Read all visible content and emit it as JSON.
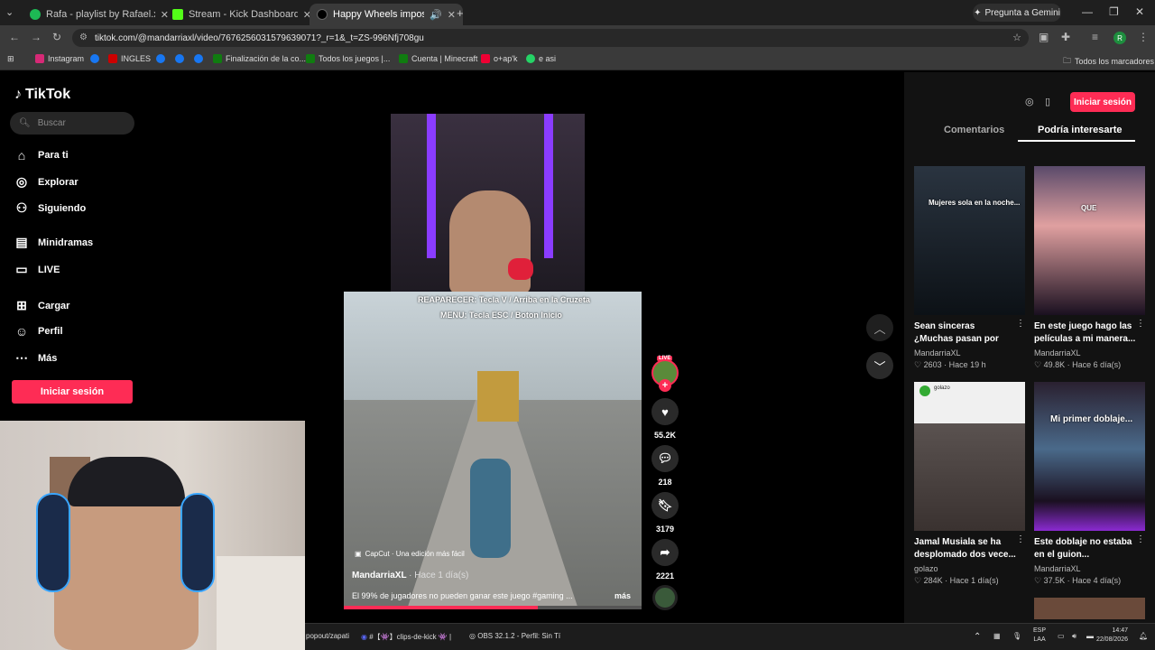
{
  "browser": {
    "tabs": [
      {
        "label": "Rafa - playlist by Rafael.xared |",
        "icon_color": "#1db954"
      },
      {
        "label": "Stream - Kick Dashboard",
        "icon_color": "#53fc18"
      },
      {
        "label": "Happy Wheels imposible: n",
        "icon_color": "#000000"
      }
    ],
    "gemini_label": "Pregunta a Gemini",
    "url": "tiktok.com/@mandarriaxl/video/7676256031579639071?_r=1&_t=ZS-996Nfj708gu",
    "bookmarks": [
      "Instagram",
      "INGLES",
      "Finalización de la co...",
      "Todos los juegos |...",
      "Cuenta | Minecraft",
      "o+ap'k",
      "e asi"
    ],
    "all_bookmarks": "Todos los marcadores"
  },
  "tiktok": {
    "logo": "TikTok",
    "search_placeholder": "Buscar",
    "nav": [
      "Para ti",
      "Explorar",
      "Siguiendo",
      "Minidramas",
      "LIVE",
      "Cargar",
      "Perfil",
      "Más"
    ],
    "login_label": "Iniciar sesión",
    "right_tabs": [
      "Comentarios",
      "Podría interesarte"
    ]
  },
  "video": {
    "overlay_line1": "REAPARECER: Tecla V / Arriba en la Cruzeta",
    "overlay_line2": "MENU: Tecla ESC / Boton Inicio",
    "capcut": "CapCut · Una edición más fácil",
    "author": "MandarriaXL",
    "time": "· Hace 1 día(s)",
    "caption": "El 99% de jugadores no pueden ganar este juego #gaming ...",
    "more": "más",
    "live_badge": "LIVE",
    "likes": "55.2K",
    "comments": "218",
    "saves": "3179",
    "shares": "2221",
    "progress": 0.65
  },
  "suggested": [
    {
      "overlay": "Mujeres sola en la noche...",
      "title": "Sean sinceras ¿Muchas pasan por esto?...",
      "author": "MandarriaXL",
      "likes": "2603",
      "time": "Hace 19 h"
    },
    {
      "overlay": "QUE",
      "title": "En este juego hago las películas a mi manera...",
      "author": "MandarriaXL",
      "likes": "49.8K",
      "time": "Hace 6 día(s)"
    },
    {
      "overlay": "golazo",
      "title": "Jamal Musiala se ha desplomado dos vece...",
      "author": "golazo",
      "likes": "284K",
      "time": "Hace 1 día(s)"
    },
    {
      "overlay": "Mi primer doblaje...",
      "title": "Este doblaje no estaba en el guion...",
      "author": "MandarriaXL",
      "likes": "37.5K",
      "time": "Hace 4 día(s)"
    }
  ],
  "taskbar": {
    "item1": "popout/zapati",
    "item2": "#【👾】clips-de-kick 👾 |",
    "item3": "OBS 32.1.2 - Perfil: Sin Tí",
    "lang1": "ESP",
    "lang2": "LAA",
    "time": "14:47",
    "date": "22/08/2026"
  }
}
